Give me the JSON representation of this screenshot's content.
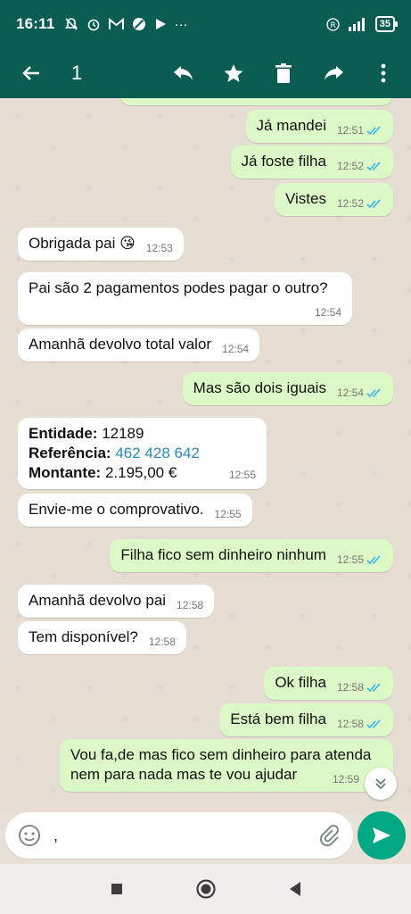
{
  "status_bar": {
    "time": "16:11",
    "battery": "35"
  },
  "toolbar": {
    "selected_count": "1"
  },
  "colors": {
    "header": "#0b5c53",
    "outgoing_bubble": "#dcf8c6",
    "incoming_bubble": "#ffffff",
    "tick_read": "#34b7f1",
    "send_button": "#00a884"
  },
  "messages": [
    {
      "dir": "out",
      "text": "Já mandei",
      "time": "12:51"
    },
    {
      "dir": "out",
      "text": "Já foste filha",
      "time": "12:52"
    },
    {
      "dir": "out",
      "text": "Vistes",
      "time": "12:52"
    },
    {
      "dir": "in",
      "text": "Obrigada pai 😘",
      "time": "12:53"
    },
    {
      "dir": "in",
      "text": "Pai são 2 pagamentos podes pagar o outro?",
      "time": "12:54"
    },
    {
      "dir": "in",
      "text": "Amanhã devolvo total valor",
      "time": "12:54"
    },
    {
      "dir": "out",
      "text": "Mas são dois iguais",
      "time": "12:54"
    },
    {
      "dir": "in",
      "entity_label": "Entidade:",
      "entity": "12189",
      "reference_label": "Referência:",
      "reference": "462 428 642",
      "amount_label": "Montante:",
      "amount": "2.195,00 €",
      "time": "12:55"
    },
    {
      "dir": "in",
      "text": "Envie-me o comprovativo.",
      "time": "12:55"
    },
    {
      "dir": "out",
      "text": "Filha fico sem dinheiro ninhum",
      "time": "12:55"
    },
    {
      "dir": "in",
      "text": "Amanhã devolvo pai",
      "time": "12:58"
    },
    {
      "dir": "in",
      "text": "Tem disponível?",
      "time": "12:58"
    },
    {
      "dir": "out",
      "text": "Ok filha",
      "time": "12:58"
    },
    {
      "dir": "out",
      "text": "Está bem filha",
      "time": "12:58"
    },
    {
      "dir": "out",
      "text": "Vou fa,de mas fico sem dinheiro para atenda nem para nada mas te vou ajudar",
      "time": "12:59"
    }
  ],
  "composer": {
    "value": ","
  }
}
